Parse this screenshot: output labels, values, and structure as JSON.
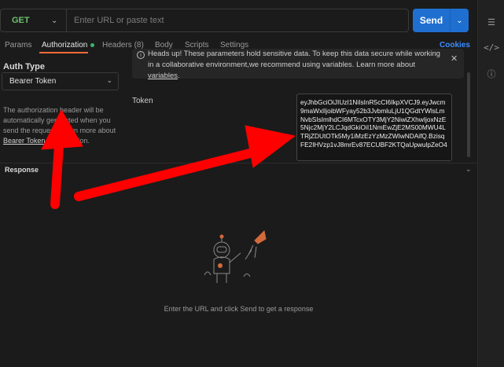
{
  "request": {
    "method": "GET",
    "url_placeholder": "Enter URL or paste text",
    "url_value": "",
    "send_label": "Send",
    "cookies_label": "Cookies"
  },
  "tabs": [
    {
      "label": "Params"
    },
    {
      "label": "Authorization"
    },
    {
      "label": "Headers (8)"
    },
    {
      "label": "Body"
    },
    {
      "label": "Scripts"
    },
    {
      "label": "Settings"
    }
  ],
  "auth": {
    "type_label": "Auth Type",
    "selected_type": "Bearer Token",
    "description_lines": [
      "The authorization header will be",
      "automatically generated when you",
      "send the request. Learn more about",
      "Bearer Token authorization."
    ]
  },
  "banner": {
    "text": "Heads up! These parameters hold sensitive data. To keep this data secure while working in a collaborative environment,we recommend using variables. Learn more about ",
    "link": "variables",
    "suffix": "."
  },
  "token": {
    "label": "Token",
    "value": "eyJhbGciOiJIUzI1NiIsInR5cCI6IkpXVCJ9.eyJwcm9maWxlIjoibWFyay52b3JvbmluLjU1QGdtYWlsLmNvbSIsImlhdCI6MTcxOTY3MjY2NiwiZXhwIjoxNzE5Njc2MjY2LCJqdGkiOiI1NmEwZjE2MS00MWU4LTRjZDUtOTk5My1iMzEzYzMzZWIwNDAifQ.BzisqFE2IHVzp1vJ8mrEv87ECUBF2KTQaUpwulpZeO4"
  },
  "response": {
    "label": "Response",
    "empty_message": "Enter the URL and click Send to get a response"
  },
  "colors": {
    "accent": "#ff6c37",
    "send": "#1f6fd0",
    "method_get": "#6cc06c",
    "arrow": "#ff0000"
  }
}
